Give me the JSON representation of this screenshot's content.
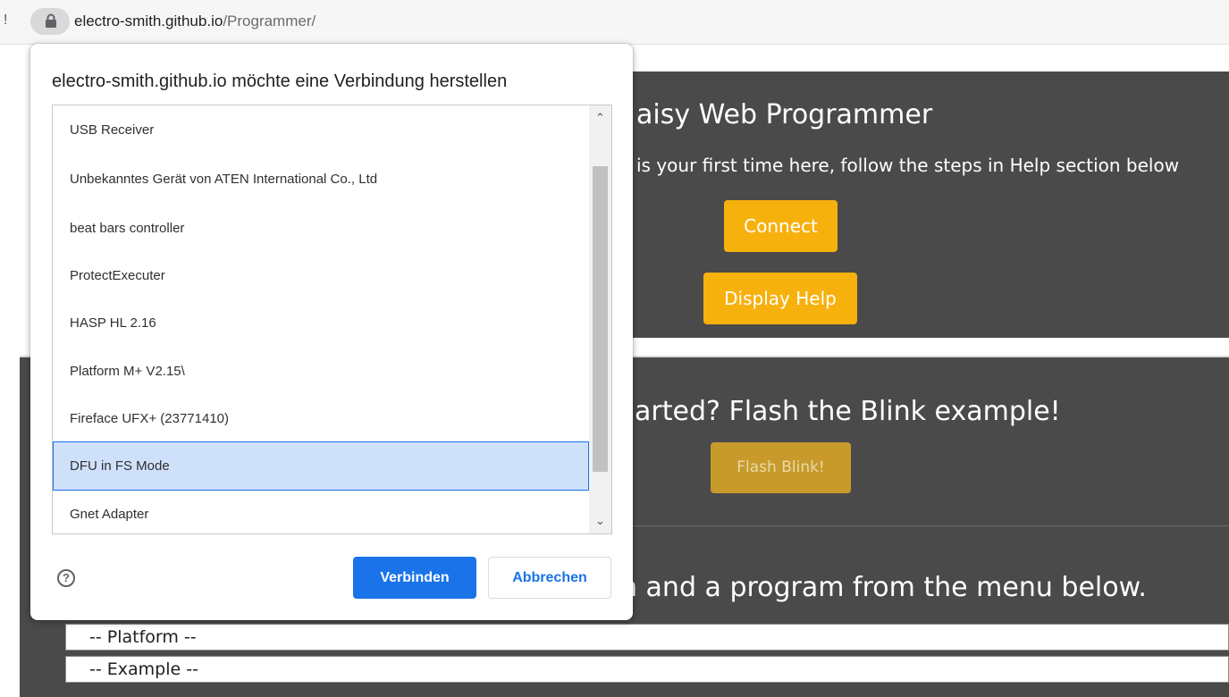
{
  "addressbar": {
    "edge_mark": "!",
    "lock_icon": "lock-icon",
    "url_domain": "electro-smith.github.io",
    "url_path": "/Programmer/"
  },
  "page": {
    "title": "aisy Web Programmer",
    "first_time_text": "is your first time here, follow the steps in Help section below",
    "connect_label": "Connect",
    "display_help_label": "Display Help",
    "flash_heading": "arted? Flash the Blink example!",
    "flash_blink_label": "Flash Blink!",
    "select_text": "n and a program from the menu below.",
    "platform_select": "-- Platform --",
    "example_select": "-- Example --",
    "colors": {
      "panel": "#4a4a4a",
      "button": "#f7b10d"
    }
  },
  "dialog": {
    "title": "electro-smith.github.io möchte eine Verbindung herstellen",
    "devices": [
      "USB Receiver",
      "Unbekanntes Gerät von ATEN International Co., Ltd",
      "beat bars controller",
      "ProtectExecuter",
      "HASP HL 2.16",
      "Platform M+ V2.15\\",
      "Fireface UFX+ (23771410)",
      "DFU in FS Mode",
      "Gnet Adapter"
    ],
    "selected_device": "DFU in FS Mode",
    "help_icon": "?",
    "connect_label": "Verbinden",
    "cancel_label": "Abbrechen",
    "scroll_up": "⌃",
    "scroll_down": "⌄",
    "colors": {
      "primary": "#1a73e8",
      "selected_bg": "#cfe0fb"
    }
  }
}
